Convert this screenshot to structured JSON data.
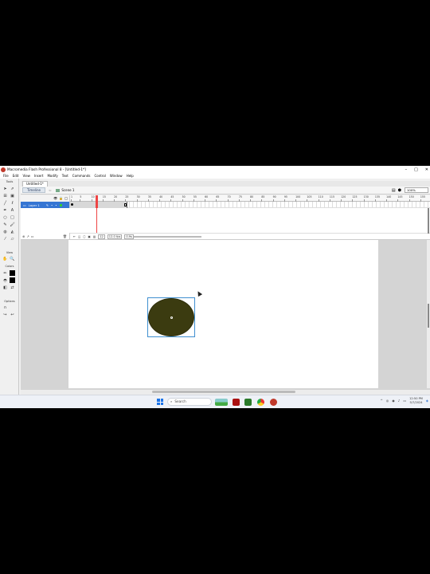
{
  "window": {
    "title": "Macromedia Flash Professional 8 - [Untitled-1*]",
    "controls": [
      "–",
      "□",
      "✕"
    ]
  },
  "menu": [
    "File",
    "Edit",
    "View",
    "Insert",
    "Modify",
    "Text",
    "Commands",
    "Control",
    "Window",
    "Help"
  ],
  "tools_panel": {
    "tools_label": "Tools",
    "view_label": "View",
    "colors_label": "Colors",
    "options_label": "Options"
  },
  "document": {
    "tab_label": "Untitled-1*"
  },
  "scene_bar": {
    "timeline_button": "Timeline",
    "scene_label": "Scene 1",
    "zoom": "100%"
  },
  "timeline": {
    "layer_name": "Layer 1",
    "ruler_ticks": [
      "1",
      "5",
      "10",
      "15",
      "20",
      "25",
      "30",
      "35",
      "40",
      "45",
      "50",
      "55",
      "60",
      "65",
      "70",
      "75",
      "80",
      "85",
      "90",
      "95",
      "100",
      "105",
      "110",
      "115",
      "120",
      "125",
      "130",
      "135",
      "140",
      "145",
      "150",
      "155"
    ],
    "current_frame": "12",
    "frame_rate": "12.0 fps",
    "elapsed_time": "0.9s"
  },
  "taskbar": {
    "search_placeholder": "Search",
    "time": "12:50 PM",
    "date": "5/7/2024"
  },
  "colors": {
    "ellipse_fill": "#3b3b10",
    "selection": "#3f8fd0",
    "playhead": "#e44444",
    "layer_selected": "#3575d3"
  }
}
